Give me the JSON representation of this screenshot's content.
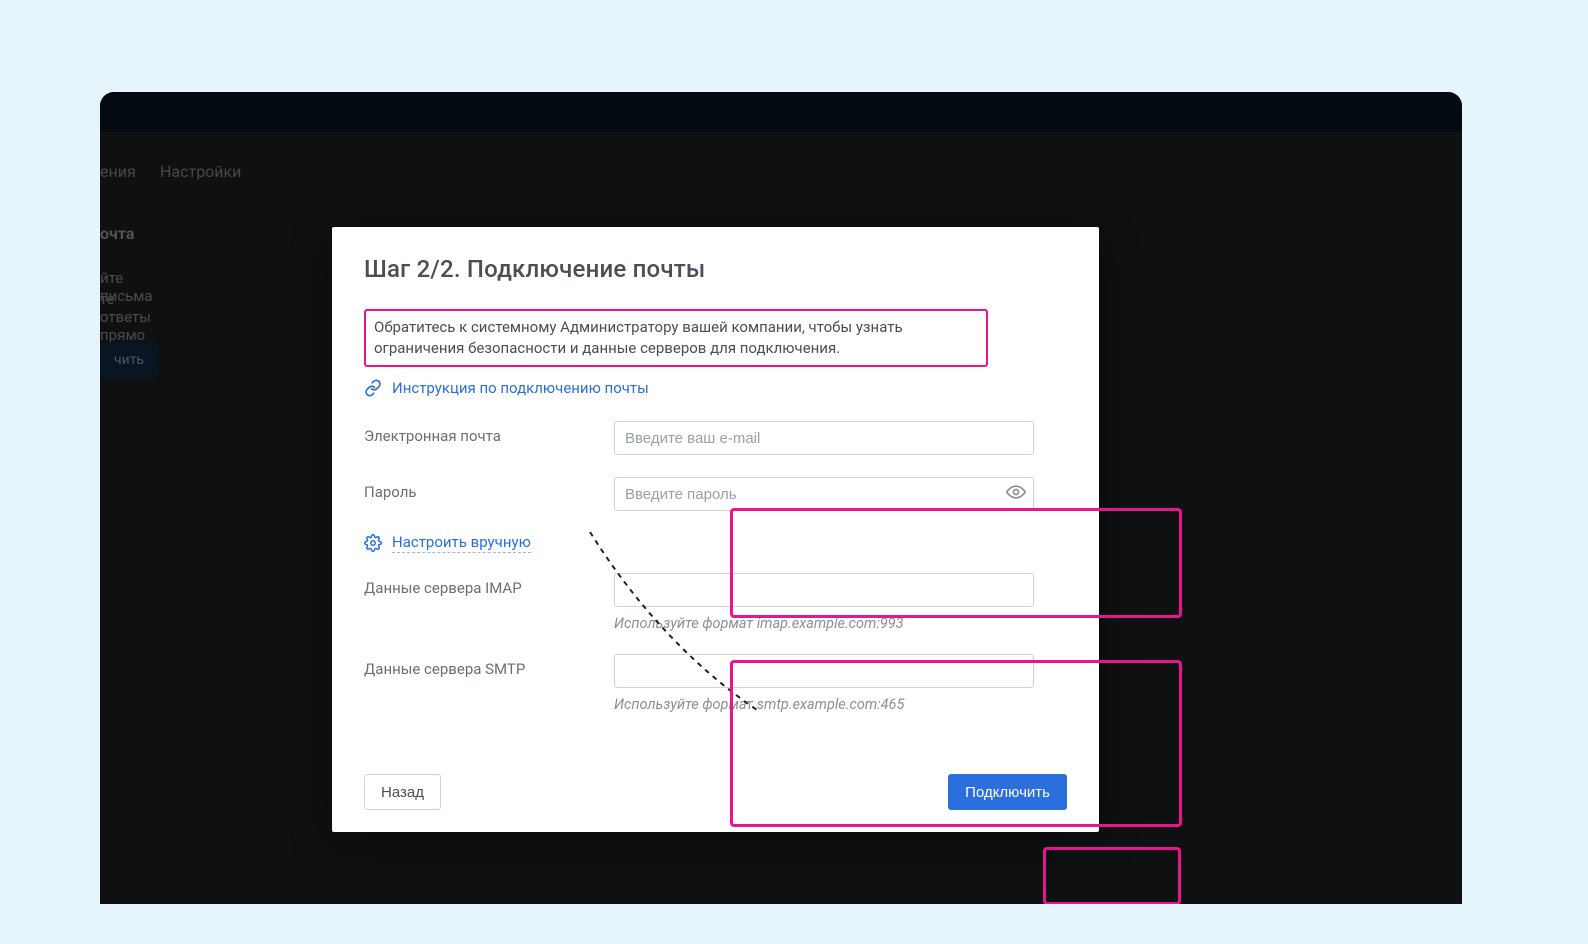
{
  "background": {
    "tab1": "ения",
    "tab2": "Настройки",
    "heading": "очта",
    "line1": "йте письма",
    "line2": "те ответы прямо",
    "button": "чить"
  },
  "modal": {
    "title": "Шаг 2/2. Подключение почты",
    "info": "Обратитесь к системному Администратору вашей компании, чтобы узнать ограничения безопасности и данные серверов для подключения.",
    "instruction_link": "Инструкция по подключению почты",
    "fields": {
      "email_label": "Электронная почта",
      "email_placeholder": "Введите ваш e-mail",
      "password_label": "Пароль",
      "password_placeholder": "Введите пароль",
      "manual_link": "Настроить вручную",
      "imap_label": "Данные сервера IMAP",
      "imap_hint": "Используйте формат imap.example.com:993",
      "smtp_label": "Данные сервера SMTP",
      "smtp_hint": "Используйте формат smtp.example.com:465"
    },
    "buttons": {
      "back": "Назад",
      "submit": "Подключить"
    }
  },
  "icons": {
    "link": "link-icon",
    "gear": "gear-icon",
    "eye": "eye-icon"
  },
  "colors": {
    "accent": "#2a6fdb",
    "annotation": "#e8168b",
    "page_bg": "#e6f4fb"
  }
}
